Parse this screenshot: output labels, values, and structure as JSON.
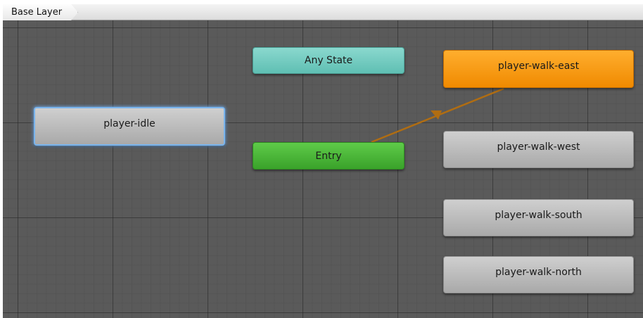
{
  "breadcrumb": {
    "layer": "Base Layer"
  },
  "colors": {
    "canvas": "#5a5a5a",
    "state_default": "#f08a00",
    "state_normal": "#b8b8b8",
    "any_state": "#6fcabe",
    "entry": "#47b234",
    "transition": "#b06d12",
    "selection": "#7ab4ec"
  },
  "states": {
    "player_idle": "player-idle",
    "any_state": "Any State",
    "entry": "Entry",
    "walk_east": "player-walk-east",
    "walk_west": "player-walk-west",
    "walk_south": "player-walk-south",
    "walk_north": "player-walk-north"
  },
  "selected_state": "player-idle",
  "default_state": "player-walk-east",
  "transitions": [
    {
      "from": "Entry",
      "to": "player-walk-east"
    }
  ]
}
